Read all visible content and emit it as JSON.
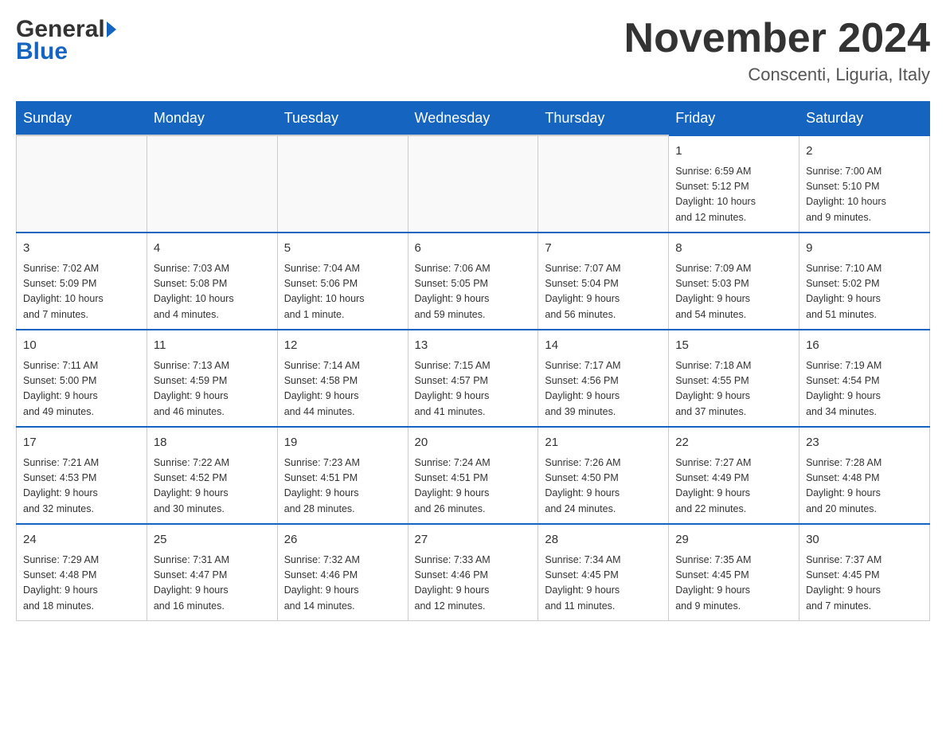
{
  "header": {
    "title": "November 2024",
    "location": "Conscenti, Liguria, Italy",
    "logo_general": "General",
    "logo_blue": "Blue"
  },
  "days_of_week": [
    "Sunday",
    "Monday",
    "Tuesday",
    "Wednesday",
    "Thursday",
    "Friday",
    "Saturday"
  ],
  "weeks": [
    [
      {
        "day": "",
        "info": ""
      },
      {
        "day": "",
        "info": ""
      },
      {
        "day": "",
        "info": ""
      },
      {
        "day": "",
        "info": ""
      },
      {
        "day": "",
        "info": ""
      },
      {
        "day": "1",
        "info": "Sunrise: 6:59 AM\nSunset: 5:12 PM\nDaylight: 10 hours\nand 12 minutes."
      },
      {
        "day": "2",
        "info": "Sunrise: 7:00 AM\nSunset: 5:10 PM\nDaylight: 10 hours\nand 9 minutes."
      }
    ],
    [
      {
        "day": "3",
        "info": "Sunrise: 7:02 AM\nSunset: 5:09 PM\nDaylight: 10 hours\nand 7 minutes."
      },
      {
        "day": "4",
        "info": "Sunrise: 7:03 AM\nSunset: 5:08 PM\nDaylight: 10 hours\nand 4 minutes."
      },
      {
        "day": "5",
        "info": "Sunrise: 7:04 AM\nSunset: 5:06 PM\nDaylight: 10 hours\nand 1 minute."
      },
      {
        "day": "6",
        "info": "Sunrise: 7:06 AM\nSunset: 5:05 PM\nDaylight: 9 hours\nand 59 minutes."
      },
      {
        "day": "7",
        "info": "Sunrise: 7:07 AM\nSunset: 5:04 PM\nDaylight: 9 hours\nand 56 minutes."
      },
      {
        "day": "8",
        "info": "Sunrise: 7:09 AM\nSunset: 5:03 PM\nDaylight: 9 hours\nand 54 minutes."
      },
      {
        "day": "9",
        "info": "Sunrise: 7:10 AM\nSunset: 5:02 PM\nDaylight: 9 hours\nand 51 minutes."
      }
    ],
    [
      {
        "day": "10",
        "info": "Sunrise: 7:11 AM\nSunset: 5:00 PM\nDaylight: 9 hours\nand 49 minutes."
      },
      {
        "day": "11",
        "info": "Sunrise: 7:13 AM\nSunset: 4:59 PM\nDaylight: 9 hours\nand 46 minutes."
      },
      {
        "day": "12",
        "info": "Sunrise: 7:14 AM\nSunset: 4:58 PM\nDaylight: 9 hours\nand 44 minutes."
      },
      {
        "day": "13",
        "info": "Sunrise: 7:15 AM\nSunset: 4:57 PM\nDaylight: 9 hours\nand 41 minutes."
      },
      {
        "day": "14",
        "info": "Sunrise: 7:17 AM\nSunset: 4:56 PM\nDaylight: 9 hours\nand 39 minutes."
      },
      {
        "day": "15",
        "info": "Sunrise: 7:18 AM\nSunset: 4:55 PM\nDaylight: 9 hours\nand 37 minutes."
      },
      {
        "day": "16",
        "info": "Sunrise: 7:19 AM\nSunset: 4:54 PM\nDaylight: 9 hours\nand 34 minutes."
      }
    ],
    [
      {
        "day": "17",
        "info": "Sunrise: 7:21 AM\nSunset: 4:53 PM\nDaylight: 9 hours\nand 32 minutes."
      },
      {
        "day": "18",
        "info": "Sunrise: 7:22 AM\nSunset: 4:52 PM\nDaylight: 9 hours\nand 30 minutes."
      },
      {
        "day": "19",
        "info": "Sunrise: 7:23 AM\nSunset: 4:51 PM\nDaylight: 9 hours\nand 28 minutes."
      },
      {
        "day": "20",
        "info": "Sunrise: 7:24 AM\nSunset: 4:51 PM\nDaylight: 9 hours\nand 26 minutes."
      },
      {
        "day": "21",
        "info": "Sunrise: 7:26 AM\nSunset: 4:50 PM\nDaylight: 9 hours\nand 24 minutes."
      },
      {
        "day": "22",
        "info": "Sunrise: 7:27 AM\nSunset: 4:49 PM\nDaylight: 9 hours\nand 22 minutes."
      },
      {
        "day": "23",
        "info": "Sunrise: 7:28 AM\nSunset: 4:48 PM\nDaylight: 9 hours\nand 20 minutes."
      }
    ],
    [
      {
        "day": "24",
        "info": "Sunrise: 7:29 AM\nSunset: 4:48 PM\nDaylight: 9 hours\nand 18 minutes."
      },
      {
        "day": "25",
        "info": "Sunrise: 7:31 AM\nSunset: 4:47 PM\nDaylight: 9 hours\nand 16 minutes."
      },
      {
        "day": "26",
        "info": "Sunrise: 7:32 AM\nSunset: 4:46 PM\nDaylight: 9 hours\nand 14 minutes."
      },
      {
        "day": "27",
        "info": "Sunrise: 7:33 AM\nSunset: 4:46 PM\nDaylight: 9 hours\nand 12 minutes."
      },
      {
        "day": "28",
        "info": "Sunrise: 7:34 AM\nSunset: 4:45 PM\nDaylight: 9 hours\nand 11 minutes."
      },
      {
        "day": "29",
        "info": "Sunrise: 7:35 AM\nSunset: 4:45 PM\nDaylight: 9 hours\nand 9 minutes."
      },
      {
        "day": "30",
        "info": "Sunrise: 7:37 AM\nSunset: 4:45 PM\nDaylight: 9 hours\nand 7 minutes."
      }
    ]
  ]
}
